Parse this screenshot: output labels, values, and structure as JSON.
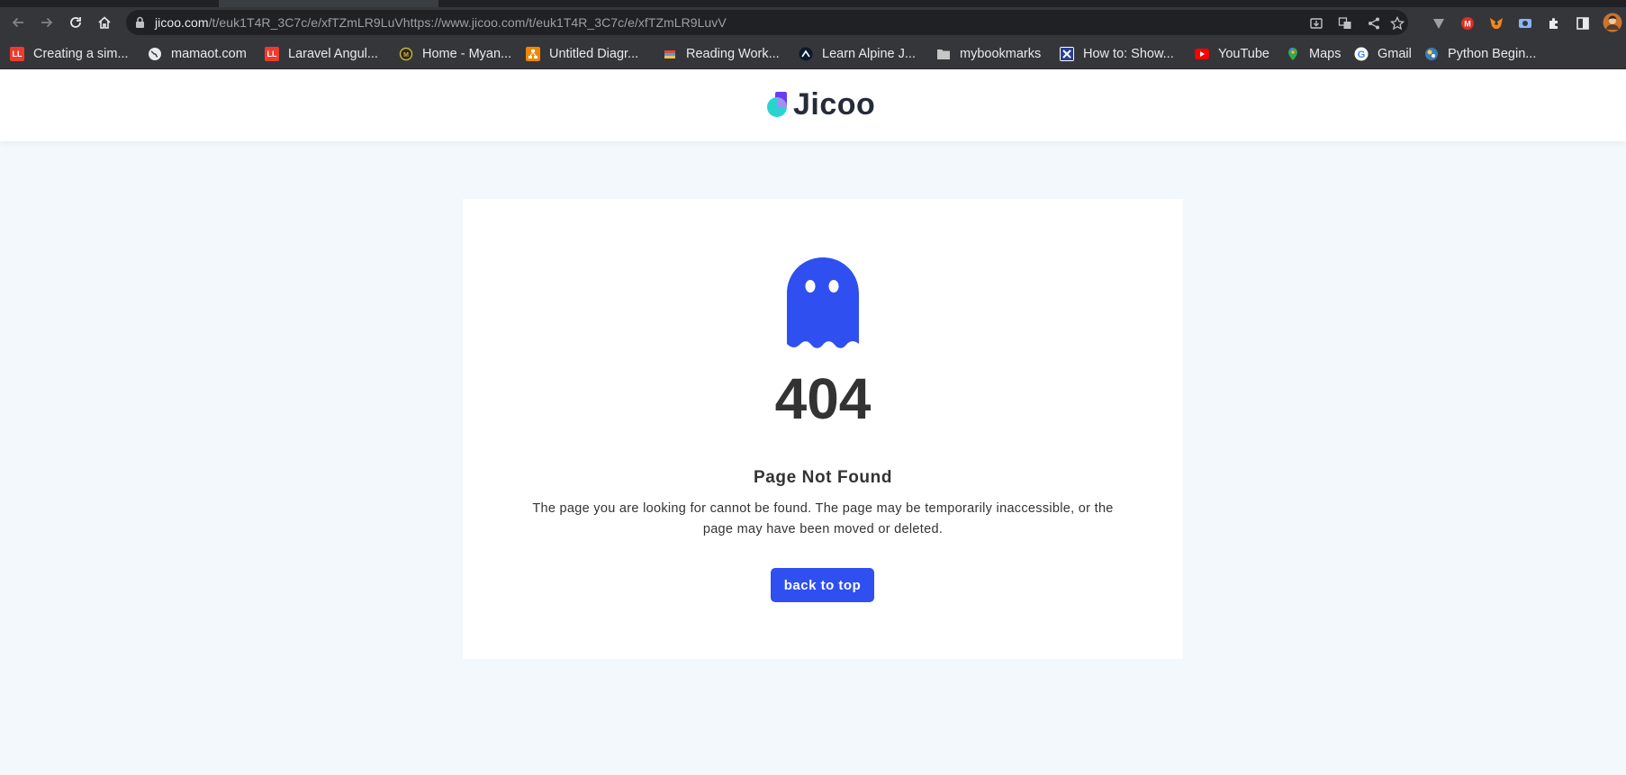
{
  "browser": {
    "url_host": "jicoo.com",
    "url_path": "/t/euk1T4R_3C7c/e/xfTZmLR9LuVhttps://www.jicoo.com/t/euk1T4R_3C7c/e/xfTZmLR9LuvV",
    "bookmarks": [
      {
        "label": "Creating a sim...",
        "icon": "laravel-icon",
        "color": "#ef3b2d"
      },
      {
        "label": "mamaot.com",
        "icon": "globe-icon",
        "color": "#e8eaed"
      },
      {
        "label": "Laravel Angul...",
        "icon": "laravel-icon",
        "color": "#ef3b2d"
      },
      {
        "label": "Home - Myan...",
        "icon": "site-icon",
        "color": "#c9b53a"
      },
      {
        "label": "Untitled Diagr...",
        "icon": "drawio-icon",
        "color": "#f08705"
      },
      {
        "label": "Reading Work...",
        "icon": "book-icon",
        "color": "#e04a3f"
      },
      {
        "label": "Learn Alpine J...",
        "icon": "alpine-icon",
        "color": "#77c1d2"
      },
      {
        "label": "mybookmarks",
        "icon": "folder-icon",
        "color": "#c4c7c5"
      },
      {
        "label": "How to: Show...",
        "icon": "x-icon",
        "color": "#4a5ff0"
      },
      {
        "label": "YouTube",
        "icon": "youtube-icon",
        "color": "#ff0000"
      },
      {
        "label": "Maps",
        "icon": "maps-icon",
        "color": "#34a853"
      },
      {
        "label": "Gmail",
        "icon": "google-icon",
        "color": "#4285f4"
      },
      {
        "label": "Python Begin...",
        "icon": "python-icon",
        "color": "#3b7bbf"
      }
    ]
  },
  "header": {
    "logo_text": "Jicoo"
  },
  "error": {
    "code": "404",
    "title": "Page Not Found",
    "description": "The page you are looking for cannot be found. The page may be temporarily inaccessible, or the page may have been moved or deleted.",
    "button_label": "back to top"
  },
  "colors": {
    "accent": "#2f4ff0",
    "page_bg": "#f3f8fc",
    "text": "#333333"
  }
}
